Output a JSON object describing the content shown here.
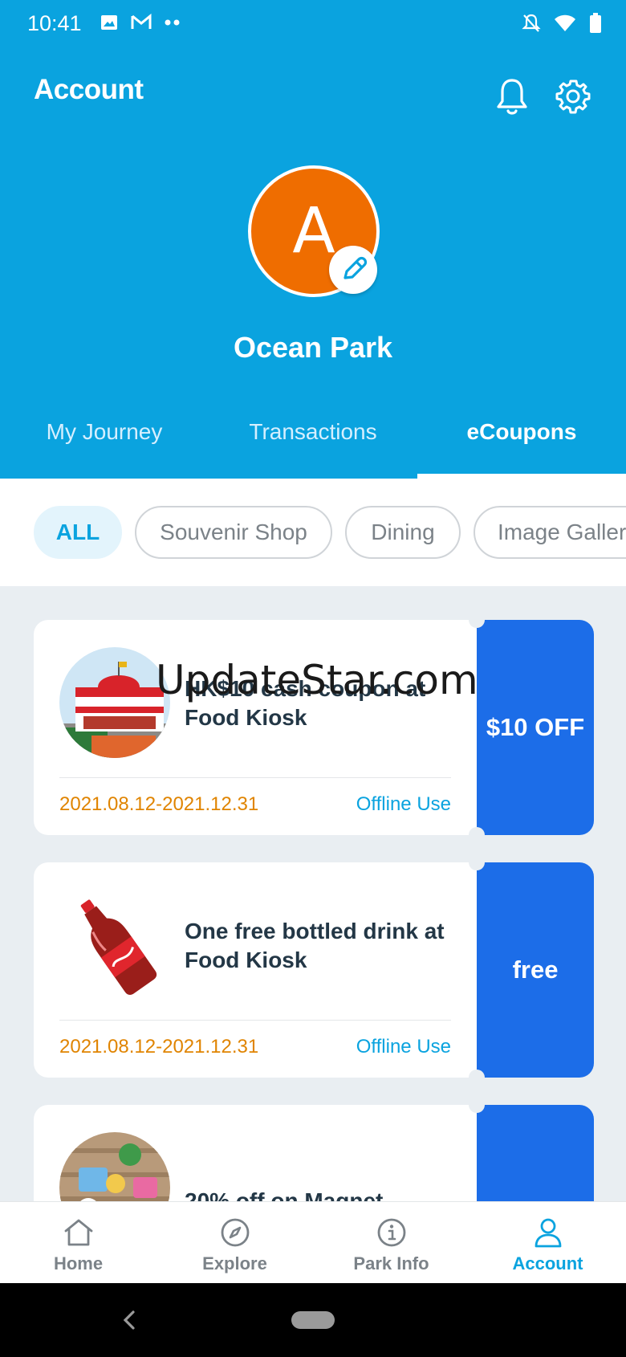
{
  "status_bar": {
    "time": "10:41"
  },
  "header": {
    "title": "Account"
  },
  "profile": {
    "initial": "A",
    "name": "Ocean Park"
  },
  "tabs": [
    {
      "label": "My Journey",
      "active": false
    },
    {
      "label": "Transactions",
      "active": false
    },
    {
      "label": "eCoupons",
      "active": true
    }
  ],
  "filters": [
    {
      "label": "ALL",
      "active": true
    },
    {
      "label": "Souvenir Shop",
      "active": false
    },
    {
      "label": "Dining",
      "active": false
    },
    {
      "label": "Image Galler",
      "active": false
    }
  ],
  "coupons": [
    {
      "title": "HK$10 cash coupon at Food Kiosk",
      "date_range": "2021.08.12-2021.12.31",
      "usage": "Offline Use",
      "value": "$10 OFF"
    },
    {
      "title": "One free bottled drink at Food Kiosk",
      "date_range": "2021.08.12-2021.12.31",
      "usage": "Offline Use",
      "value": "free"
    },
    {
      "title": "20% off on Magnet",
      "date_range": "",
      "usage": "",
      "value": ""
    }
  ],
  "bottom_nav": [
    {
      "label": "Home",
      "icon": "home-icon",
      "active": false
    },
    {
      "label": "Explore",
      "icon": "compass-icon",
      "active": false
    },
    {
      "label": "Park Info",
      "icon": "info-icon",
      "active": false
    },
    {
      "label": "Account",
      "icon": "user-icon",
      "active": true
    }
  ],
  "watermark": "UpdateStar.com",
  "colors": {
    "primary": "#0aa3df",
    "coupon_blue": "#1c6de8",
    "avatar_orange": "#ef6d00",
    "date_orange": "#e08400"
  }
}
